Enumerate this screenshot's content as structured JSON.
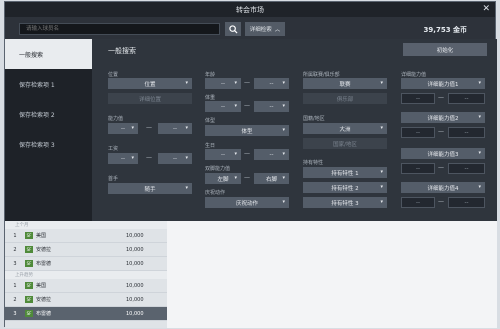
{
  "title": "转会市场",
  "search": {
    "placeholder": "请输入球员名",
    "detail_label": "详细检索",
    "coins": "39,753 金币"
  },
  "sidebar": {
    "items": [
      {
        "label": "一般搜索"
      },
      {
        "label": "保存检索项 1"
      },
      {
        "label": "保存检索项 2"
      },
      {
        "label": "保存检索项 3"
      }
    ]
  },
  "panel": {
    "title": "一般搜索",
    "reset_label": "初始化",
    "position": {
      "label": "位置",
      "dropdown": "位置",
      "detail_btn": "详细位置"
    },
    "ability": {
      "label": "能力值",
      "from": "--",
      "to": "--"
    },
    "salary": {
      "label": "工资",
      "from": "--",
      "to": "--"
    },
    "foot": {
      "label": "首手",
      "value": "随手"
    },
    "age": {
      "label": "年龄",
      "from": "--",
      "to": "--"
    },
    "height": {
      "label": "体重",
      "from": "--",
      "to": "--"
    },
    "body_type": {
      "label": "体型",
      "value": "体型"
    },
    "weight": {
      "label": "生日",
      "from": "--",
      "to": "--"
    },
    "both_feet": {
      "label": "双脚能力值",
      "left": "左脚",
      "right": "右脚"
    },
    "celebration": {
      "label": "庆祝动作",
      "value": "庆祝动作"
    },
    "league": {
      "label": "所属联赛/俱乐部",
      "dropdown": "联赛",
      "sub": "俱乐部"
    },
    "nation": {
      "label": "国籍/地区",
      "dropdown": "大洲",
      "sub": "国家/地区"
    },
    "traits": {
      "label": "持有特性",
      "items": [
        "持有特性 1",
        "持有特性 2",
        "持有特性 3"
      ]
    },
    "detail_abilities": {
      "label": "详细能力值",
      "items": [
        "详细能力值1",
        "详细能力值2",
        "详细能力值3",
        "详细能力值4"
      ]
    }
  },
  "results": {
    "groups": [
      {
        "label": "上个月",
        "rows": [
          {
            "idx": "1",
            "pos": "SF",
            "name": "美国",
            "price": "10,000"
          },
          {
            "idx": "2",
            "pos": "SF",
            "name": "安德拉",
            "price": "10,000"
          },
          {
            "idx": "3",
            "pos": "SF",
            "name": "布雷德",
            "price": "10,000"
          }
        ]
      },
      {
        "label": "上升趋势",
        "rows": [
          {
            "idx": "1",
            "pos": "SF",
            "name": "美国",
            "price": "10,000"
          },
          {
            "idx": "2",
            "pos": "SF",
            "name": "安德拉",
            "price": "10,000"
          },
          {
            "idx": "3",
            "pos": "SF",
            "name": "布雷德",
            "price": "10,000"
          }
        ]
      }
    ]
  }
}
